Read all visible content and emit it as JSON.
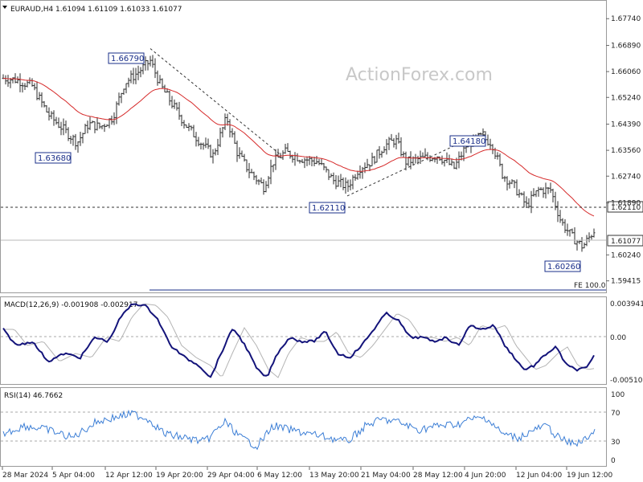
{
  "watermark": "ActionForex.com",
  "main": {
    "header": "EURAUD,H4  1.61094 1.61109 1.61033 1.61077",
    "ylim": [
      1.5915,
      1.6818
    ],
    "yticks": [
      "1.67740",
      "1.66890",
      "1.66060",
      "1.65240",
      "1.64390",
      "1.63560",
      "1.62740",
      "1.61890",
      "1.60240",
      "1.59415"
    ],
    "price_tag": "1.61077",
    "dashed_tag": "1.62110",
    "fe_label": "FE 100.0",
    "labels": {
      "h1": "1.66790",
      "l1": "1.63680",
      "l2": "1.62110",
      "h2": "1.64180",
      "l3": "1.60260"
    }
  },
  "macd": {
    "header": "MACD(12,26,9) -0.001908 -0.002917",
    "yticks": [
      "0.003941",
      "0.00",
      "-0.005103"
    ]
  },
  "rsi": {
    "header": "RSI(14) 46.7662",
    "yticks": [
      "100",
      "70",
      "30",
      "0"
    ]
  },
  "xaxis": [
    "28 Mar 2024",
    "5 Apr 04:00",
    "12 Apr 12:00",
    "19 Apr 20:00",
    "29 Apr 04:00",
    "6 May 12:00",
    "13 May 20:00",
    "21 May 04:00",
    "28 May 12:00",
    "4 Jun 20:00",
    "12 Jun 04:00",
    "19 Jun 12:00"
  ],
  "colors": {
    "bars": "#2b2b2b",
    "ma": "#d62a2a",
    "macd": "#13137a",
    "signal": "#b4b4b4",
    "rsi": "#3d7fd6",
    "label_border": "#1a2f8a"
  },
  "chart_data": [
    {
      "type": "ohlc",
      "title": "EURAUD,H4",
      "last": {
        "open": 1.61094,
        "high": 1.61109,
        "low": 1.61033,
        "close": 1.61077
      },
      "ylim": [
        1.5915,
        1.6818
      ],
      "series": [
        {
          "name": "price",
          "x": [
            "28 Mar 2024",
            "5 Apr 04:00",
            "12 Apr 12:00",
            "19 Apr 20:00",
            "29 Apr 04:00",
            "6 May 12:00",
            "13 May 20:00",
            "21 May 04:00",
            "28 May 12:00",
            "4 Jun 20:00",
            "12 Jun 04:00",
            "19 Jun 12:00"
          ],
          "values": [
            1.659,
            1.6368,
            1.6625,
            1.6545,
            1.645,
            1.63,
            1.6211,
            1.639,
            1.633,
            1.6418,
            1.622,
            1.6026
          ]
        }
      ],
      "annotations": [
        {
          "label": "1.66790",
          "x": "16 Apr",
          "y": 1.6679
        },
        {
          "label": "1.63680",
          "x": "8 Apr",
          "y": 1.6368
        },
        {
          "label": "1.62110",
          "x": "14 May",
          "y": 1.6211
        },
        {
          "label": "1.64180",
          "x": "5 Jun",
          "y": 1.6418
        },
        {
          "label": "1.60260",
          "x": "20 Jun",
          "y": 1.6026
        }
      ],
      "hline": 1.6211
    },
    {
      "type": "line",
      "title": "MACD(12,26,9)",
      "ylim": [
        -0.0062,
        0.0043
      ],
      "series": [
        {
          "name": "MACD",
          "last": -0.001908
        },
        {
          "name": "signal",
          "last": -0.002917
        }
      ]
    },
    {
      "type": "line",
      "title": "RSI(14)",
      "ylim": [
        0,
        100
      ],
      "series": [
        {
          "name": "RSI",
          "last": 46.7662
        }
      ],
      "levels": [
        70,
        30
      ]
    }
  ]
}
